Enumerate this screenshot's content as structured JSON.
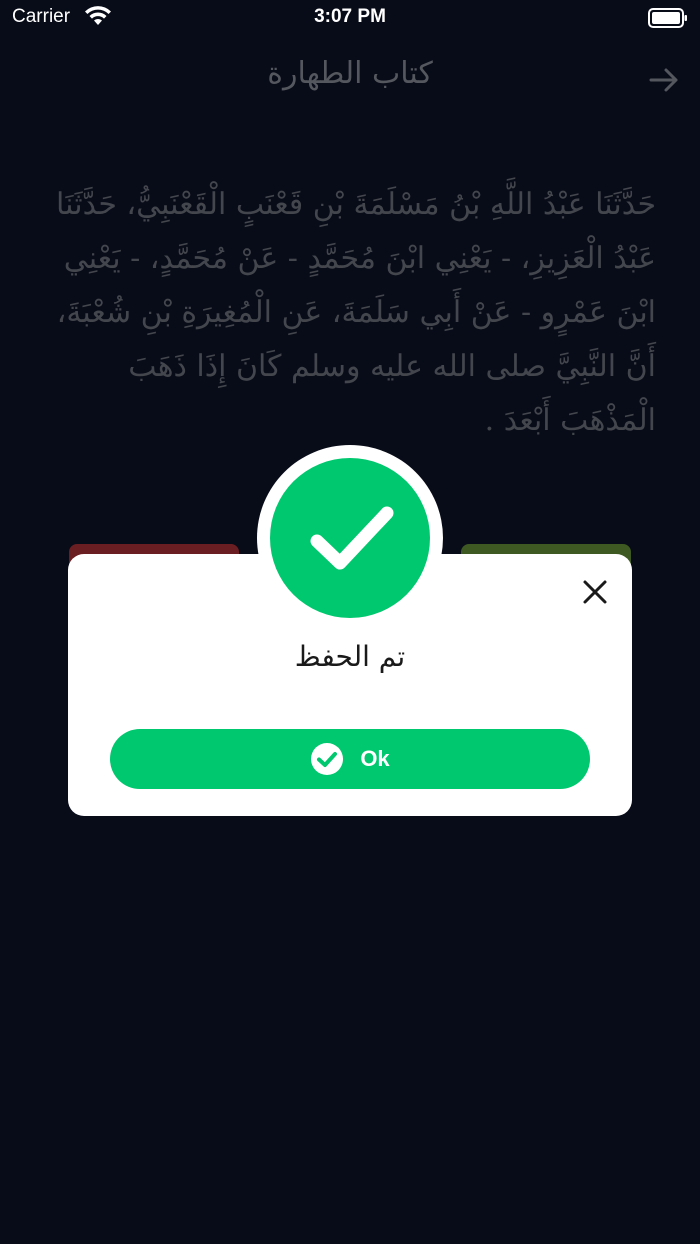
{
  "status_bar": {
    "carrier": "Carrier",
    "time": "3:07 PM"
  },
  "nav": {
    "title": "كتاب الطهارة",
    "back_icon": "arrow-right-icon"
  },
  "hadith": {
    "text": "حَدَّثَنَا عَبْدُ اللَّهِ بْنُ مَسْلَمَةَ بْنِ قَعْنَبٍ الْقَعْنَبِيُّ، حَدَّثَنَا عَبْدُ الْعَزِيزِ، - يَعْنِي ابْنَ مُحَمَّدٍ - عَنْ مُحَمَّدٍ، - يَعْنِي ابْنَ عَمْرٍو - عَنْ أَبِي سَلَمَةَ، عَنِ الْمُغِيرَةِ بْنِ شُعْبَةَ، أَنَّ النَّبِيَّ صلى الله عليه وسلم كَانَ إِذَا ذَهَبَ الْمَذْهَبَ أَبْعَدَ ."
  },
  "modal": {
    "title": "تم الحفظ",
    "ok_label": "Ok",
    "icon": "checkmark-icon",
    "close_icon": "close-icon"
  },
  "colors": {
    "background": "#080c18",
    "accent_green": "#00c86e",
    "dim_red": "#6a1e22",
    "dim_green": "#3e5a22"
  }
}
